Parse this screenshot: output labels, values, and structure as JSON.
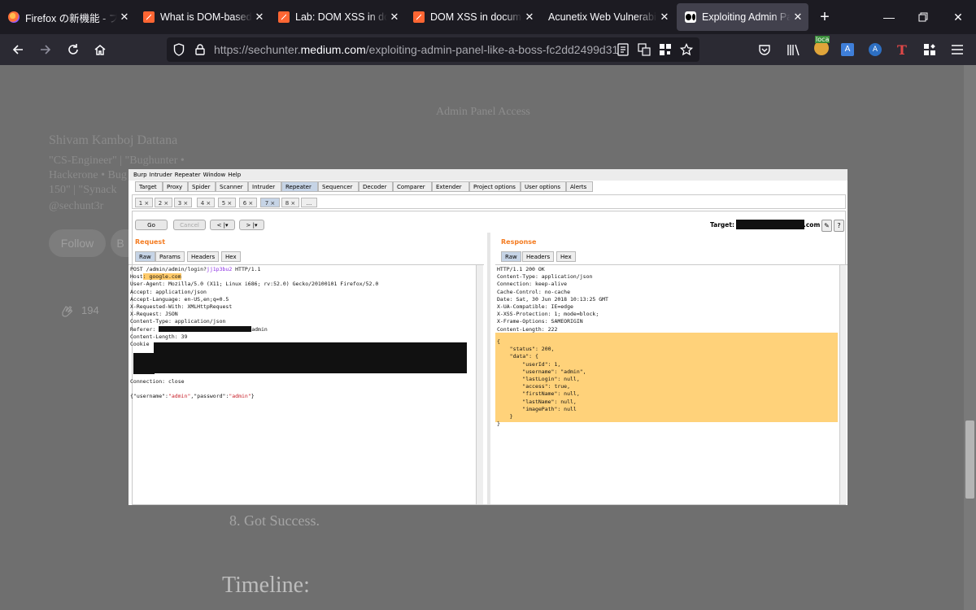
{
  "browser": {
    "tabs": [
      {
        "title": "Firefox の新機能 - ブラウ",
        "favicon": "firefox-icon"
      },
      {
        "title": "What is DOM-based XSS",
        "favicon": "portswigger-icon"
      },
      {
        "title": "Lab: DOM XSS in docu",
        "favicon": "portswigger-icon"
      },
      {
        "title": "DOM XSS in document",
        "favicon": "portswigger-icon"
      },
      {
        "title": "Acunetix Web Vulnerability",
        "favicon": ""
      },
      {
        "title": "Exploiting Admin Pane",
        "favicon": "medium-icon",
        "active": true
      }
    ],
    "url_prefix": "https://sechunter.",
    "url_domain": "medium.com",
    "url_path": "/exploiting-admin-panel-like-a-boss-fc2dd2499d31",
    "ext_badge": "loca"
  },
  "article": {
    "heading_top": "Admin Panel Access",
    "author_name": "Shivam Kamboj Dattana",
    "author_bio_1": "\"CS-Engineer\" | \"Bughunter •",
    "author_bio_2": "Hackerone • Bug",
    "author_bio_3": "150\" | \"Synack",
    "author_handle": "@sechunt3r",
    "follow_label": "Follow",
    "follow_label_2": "B",
    "clap_count": "194",
    "caption": "8. Got Success.",
    "section_title": "Timeline:"
  },
  "burp": {
    "menu": [
      "Burp",
      "Intruder",
      "Repeater",
      "Window",
      "Help"
    ],
    "tabs": [
      "Target",
      "Proxy",
      "Spider",
      "Scanner",
      "Intruder",
      "Repeater",
      "Sequencer",
      "Decoder",
      "Comparer",
      "Extender",
      "Project options",
      "User options",
      "Alerts"
    ],
    "num_tabs": [
      "1 ×",
      "2 ×",
      "3 ×",
      "4 ×",
      "5 ×",
      "6 ×",
      "7 ×",
      "8 ×",
      "..."
    ],
    "go": "Go",
    "cancel": "Cancel",
    "back": "< |▾",
    "fwd": "> |▾",
    "target_label": "Target:",
    "target_suffix": ".com",
    "request_label": "Request",
    "response_label": "Response",
    "req_tabs": [
      "Raw",
      "Params",
      "Headers",
      "Hex"
    ],
    "resp_tabs": [
      "Raw",
      "Headers",
      "Hex"
    ],
    "request": {
      "line1_a": "POST /admin/admin/login?",
      "line1_b": "jj1p3bu2",
      "line1_c": " HTTP/1.1",
      "host_a": "Host",
      "host_b": ": google.com",
      "lines": [
        "User-Agent: Mozilla/5.0 (X11; Linux i686; rv:52.0) Gecko/20100101 Firefox/52.0",
        "Accept: application/json",
        "Accept-Language: en-US,en;q=0.5",
        "X-Requested-With: XMLHttpRequest",
        "X-Request: JSON",
        "Content-Type: application/json"
      ],
      "referer_a": "Referer: ",
      "referer_b": "admin",
      "content_length": "Content-Length: 39",
      "cookie": "Cookie",
      "connection": "Connection: close",
      "body_1": "{\"username\"",
      "body_2": ":",
      "body_3": "\"admin\"",
      "body_4": ",",
      "body_5": "\"password\"",
      "body_6": ":",
      "body_7": "\"admin\"",
      "body_8": "}"
    },
    "response": {
      "headers": [
        "HTTP/1.1 200 OK",
        "Content-Type: application/json",
        "Connection: keep-alive",
        "Cache-Control: no-cache",
        "Date: Sat, 30 Jun 2018 10:13:25 GMT",
        "X-UA-Compatible: IE=edge",
        "X-XSS-Protection: 1; mode=block;",
        "X-Frame-Options: SAMEORIGIN",
        "Content-Length: 222"
      ],
      "body": [
        "{",
        "    \"status\": 200,",
        "    \"data\": {",
        "        \"userId\": 1,",
        "        \"username\": \"admin\",",
        "        \"lastLogin\": null,",
        "        \"access\": true,",
        "        \"firstName\": null,",
        "        \"lastName\": null,",
        "        \"imagePath\": null",
        "    }",
        "}"
      ]
    }
  }
}
